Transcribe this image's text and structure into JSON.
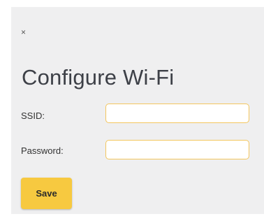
{
  "dialog": {
    "close_label": "×",
    "title": "Configure Wi-Fi",
    "fields": {
      "ssid": {
        "label": "SSID:",
        "value": "",
        "placeholder": ""
      },
      "password": {
        "label": "Password:",
        "value": "",
        "placeholder": ""
      }
    },
    "save_label": "Save"
  },
  "colors": {
    "panel_background": "#efeff0",
    "accent": "#f7c940",
    "input_border": "#f3c65e",
    "title_text": "#3d4047"
  }
}
